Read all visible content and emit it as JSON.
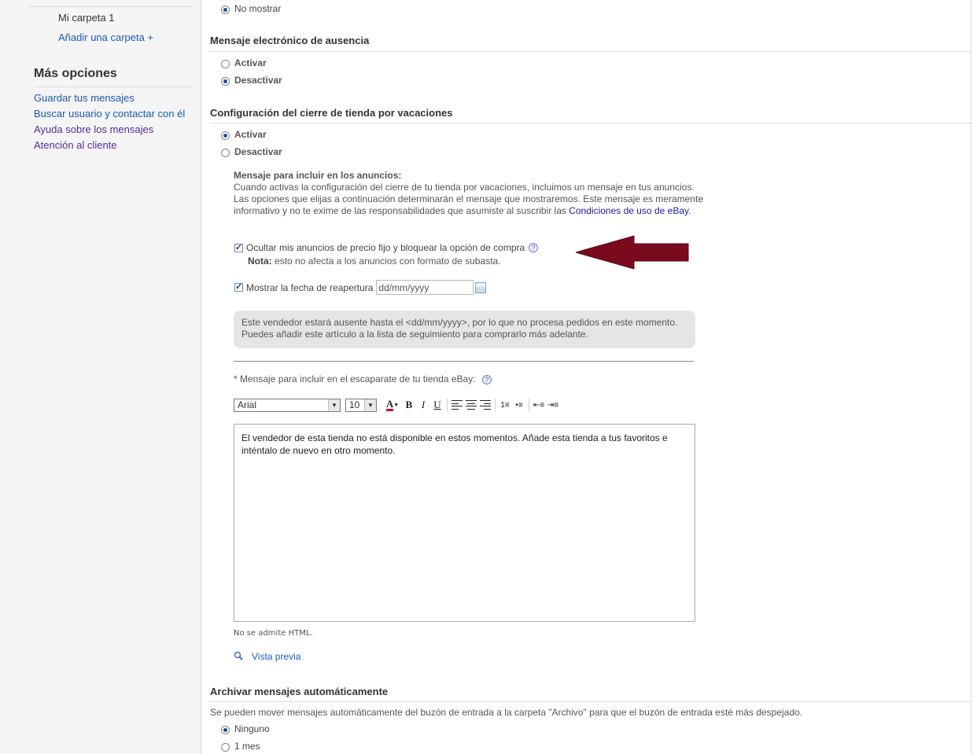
{
  "sidebar": {
    "folder_name": "Mi carpeta 1",
    "add_folder": "Añadir una carpeta +",
    "more_title": "Más opciones",
    "links": [
      "Guardar tus mensajes",
      "Buscar usuario y contactar con él",
      "Ayuda sobre los mensajes",
      "Atención al cliente"
    ]
  },
  "main": {
    "top_option": "No mostrar",
    "absence": {
      "title": "Mensaje electrónico de ausencia",
      "opt_on": "Activar",
      "opt_off": "Desactivar",
      "selected": "Desactivar"
    },
    "vacation": {
      "title": "Configuración del cierre de tienda por vacaciones",
      "opt_on": "Activar",
      "opt_off": "Desactivar",
      "selected": "Activar",
      "info_head": "Mensaje para incluir en los anuncios:",
      "info_body": "Cuando activas la configuración del cierre de tu tienda por vacaciones, incluimos un mensaje en tus anuncios. Las opciones que elijas a continuación determinarán el mensaje que mostraremos. Este mensaje es meramente informativo y no te exime de las responsabilidades que asumiste al suscribir las",
      "info_link": "Condiciones de uso de eBay",
      "info_end": ".",
      "hide_listings": "Ocultar mis anuncios de precio fijo y bloquear la opción de compra",
      "note_label": "Nota:",
      "note_text": "esto no afecta a los anuncios con formato de subasta.",
      "show_date": "Mostrar la fecha de reapertura",
      "date_value": "dd/mm/yyyy",
      "bubble": "Este vendedor estará ausente hasta el <dd/mm/yyyy>, por lo que no procesa pedidos en este momento. Puedes añadir este artículo a la lista de seguimiento para comprarlo más adelante.",
      "store_label": "*  Mensaje para incluir en el escaparate de tu tienda eBay:",
      "font": "Arial",
      "size": "10",
      "editor_text": "El vendedor de esta tienda no está disponible en estos momentos. Añade esta tienda a tus favoritos e inténtalo de nuevo en otro momento.",
      "no_html": "No se admite HTML.",
      "preview": "Vista previa"
    },
    "archive": {
      "title": "Archivar mensajes automáticamente",
      "desc": "Se pueden mover mensajes automáticamente del buzón de entrada a la carpeta \"Archivo\" para que el buzón de entrada esté más despejado.",
      "opt_none": "Ninguno",
      "opt_month": "1 mes",
      "selected": "Ninguno"
    }
  },
  "colors": {
    "link": "#1c5bb5",
    "visited": "#5a2a9a",
    "arrow": "#7a0a1e"
  }
}
